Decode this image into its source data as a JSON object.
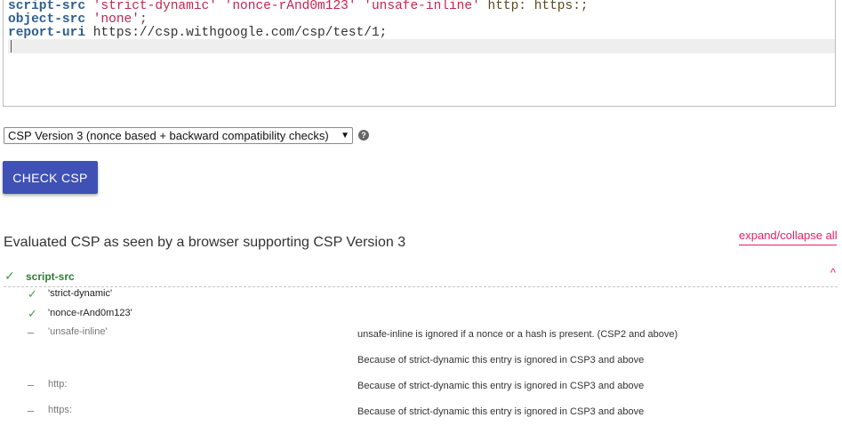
{
  "editor": {
    "lines": [
      {
        "directive": "script-src",
        "values": "'strict-dynamic' 'nonce-rAnd0m123' 'unsafe-inline'",
        "extra": " http: https:",
        "end": ";"
      },
      {
        "directive": "object-src",
        "values": "'none'",
        "extra": "",
        "end": ";"
      },
      {
        "directive": "report-uri",
        "values": "",
        "extra": " https://csp.withgoogle.com/csp/test/1",
        "end": ";"
      }
    ]
  },
  "version_select": {
    "selected": "CSP Version 3 (nonce based + backward compatibility checks)",
    "help_icon": "question-circle-icon"
  },
  "check_button": "CHECK CSP",
  "results": {
    "title": "Evaluated CSP as seen by a browser supporting CSP Version 3",
    "expand_collapse": "expand/collapse all",
    "directive": {
      "name": "script-src",
      "status_icon": "check-icon",
      "toggle_icon": "chevron-up-icon",
      "values": [
        {
          "value": "'strict-dynamic'",
          "status": "ok",
          "findings": []
        },
        {
          "value": "'nonce-rAnd0m123'",
          "status": "ok",
          "findings": []
        },
        {
          "value": "'unsafe-inline'",
          "status": "ignored",
          "findings": [
            "unsafe-inline is ignored if a nonce or a hash is present. (CSP2 and above)",
            "Because of strict-dynamic this entry is ignored in CSP3 and above"
          ]
        },
        {
          "value": "http:",
          "status": "ignored",
          "findings": [
            "Because of strict-dynamic this entry is ignored in CSP3 and above"
          ]
        },
        {
          "value": "https:",
          "status": "ignored",
          "findings": [
            "Because of strict-dynamic this entry is ignored in CSP3 and above"
          ]
        }
      ]
    }
  },
  "colors": {
    "accent": "#3f51b5",
    "link": "#e91e63",
    "ok": "#43a047",
    "directive": "#2e7d32"
  }
}
